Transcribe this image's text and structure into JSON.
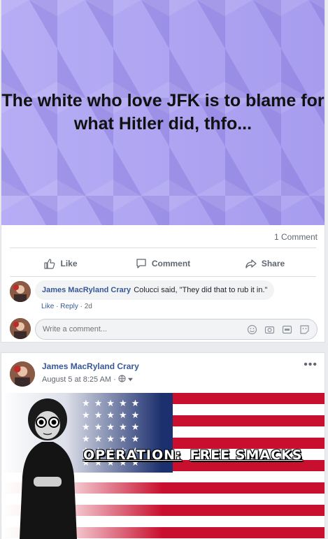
{
  "post1": {
    "banner_text": "The white who love JFK is to blame for what Hitler did, thfo...",
    "comment_count": "1 Comment",
    "actions": {
      "like": "Like",
      "comment": "Comment",
      "share": "Share"
    }
  },
  "comment": {
    "author": "James MacRyland Crary",
    "text": "Colucci said, \"They did that to rub it in.\"",
    "like": "Like",
    "sep1": " · ",
    "reply": "Reply",
    "sep2": " · ",
    "time": "2d"
  },
  "write_comment": {
    "placeholder": "Write a comment...",
    "icons": [
      "emoji-icon",
      "camera-icon",
      "gif-icon",
      "sticker-icon"
    ]
  },
  "post2": {
    "author": "James MacRyland Crary",
    "timestamp": "August 5 at 8:25 AM",
    "privacy_sep": " · ",
    "image_text_1": "OPERATION:",
    "image_text_2": "FREE SMACKS"
  },
  "colors": {
    "link": "#385898",
    "meta": "#606770",
    "banner": "#a99ef0",
    "flag_red": "#c8102e",
    "flag_blue": "#1c2f6e"
  }
}
